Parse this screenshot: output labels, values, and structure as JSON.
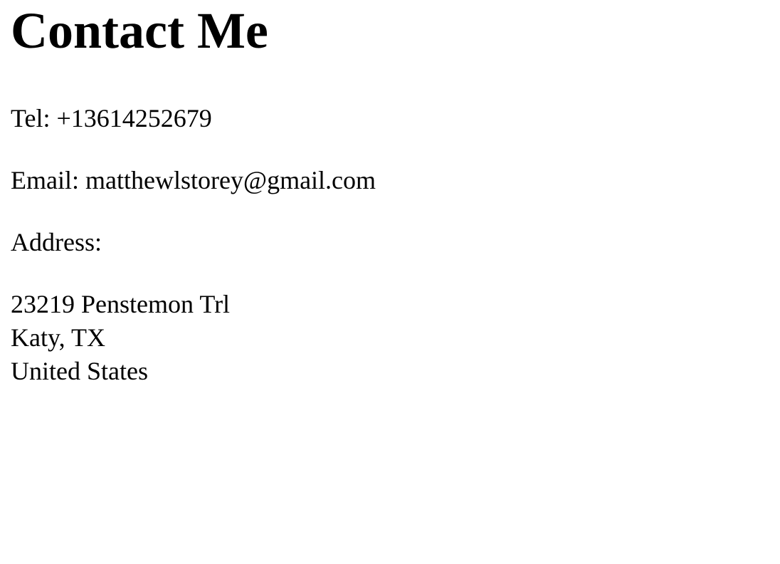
{
  "page": {
    "heading": "Contact Me",
    "tel": "Tel: +13614252679",
    "email": "Email: matthewlstorey@gmail.com",
    "address_label": "Address:",
    "address_lines": [
      "23219 Penstemon Trl",
      "Katy, TX",
      "United States"
    ]
  },
  "colors": {
    "text": "#000000",
    "background": "#ffffff"
  }
}
